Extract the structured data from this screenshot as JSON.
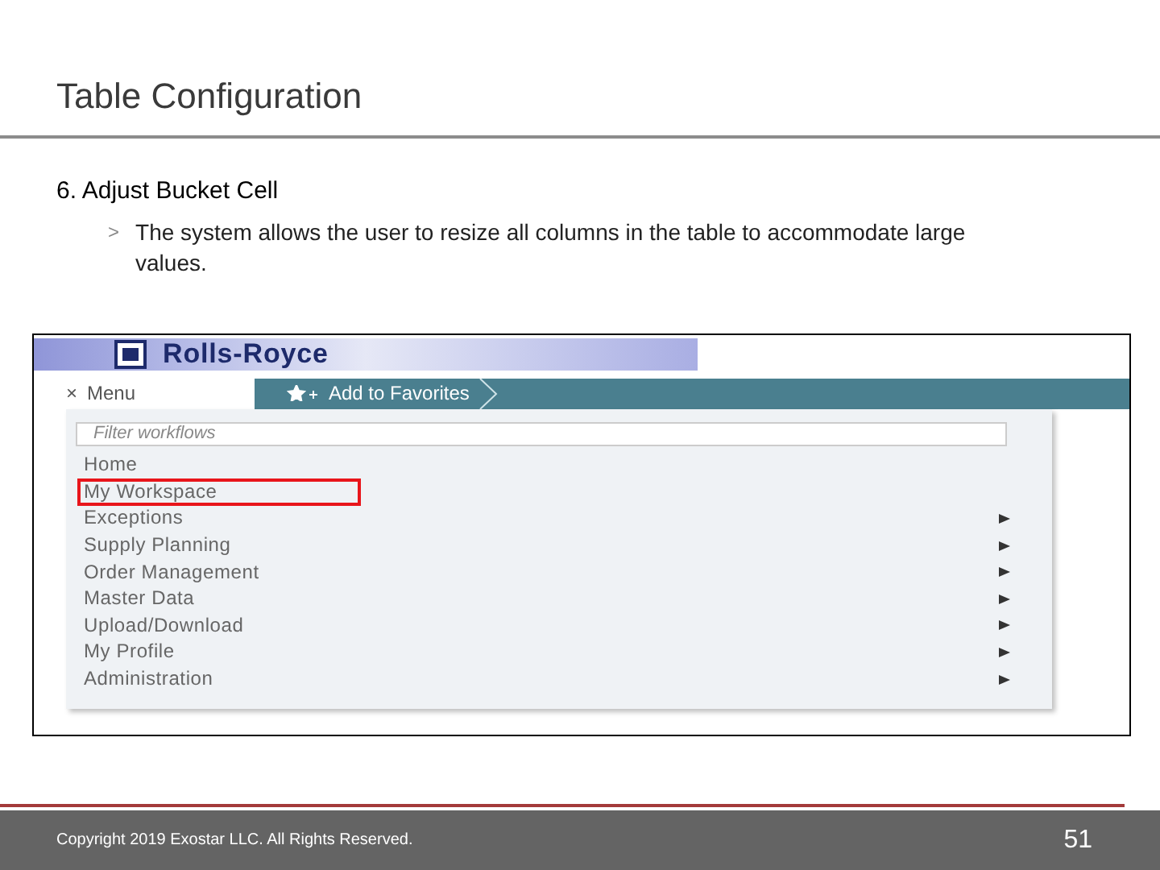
{
  "slide": {
    "title": "Table Configuration",
    "step": "6. Adjust Bucket Cell",
    "bullet_marker": ">",
    "bullet": "The system allows the user to resize all columns in the table to accommodate large values."
  },
  "screenshot": {
    "brand": "Rolls-Royce",
    "menu_toggle": {
      "icon": "×",
      "label": "Menu"
    },
    "favorites_button": "Add to Favorites",
    "filter": {
      "placeholder": "Filter workflows"
    },
    "menu_items": [
      {
        "label": "Home",
        "highlighted": false,
        "submenu": false
      },
      {
        "label": "My Workspace",
        "highlighted": true,
        "submenu": false
      },
      {
        "label": "Exceptions",
        "highlighted": false,
        "submenu": true
      },
      {
        "label": "Supply Planning",
        "highlighted": false,
        "submenu": true
      },
      {
        "label": "Order Management",
        "highlighted": false,
        "submenu": true
      },
      {
        "label": "Master Data",
        "highlighted": false,
        "submenu": true
      },
      {
        "label": "Upload/Download",
        "highlighted": false,
        "submenu": true
      },
      {
        "label": "My Profile",
        "highlighted": false,
        "submenu": true
      },
      {
        "label": "Administration",
        "highlighted": false,
        "submenu": true
      }
    ]
  },
  "footer": {
    "copyright": "Copyright 2019 Exostar LLC. All Rights Reserved.",
    "page_number": "51"
  }
}
